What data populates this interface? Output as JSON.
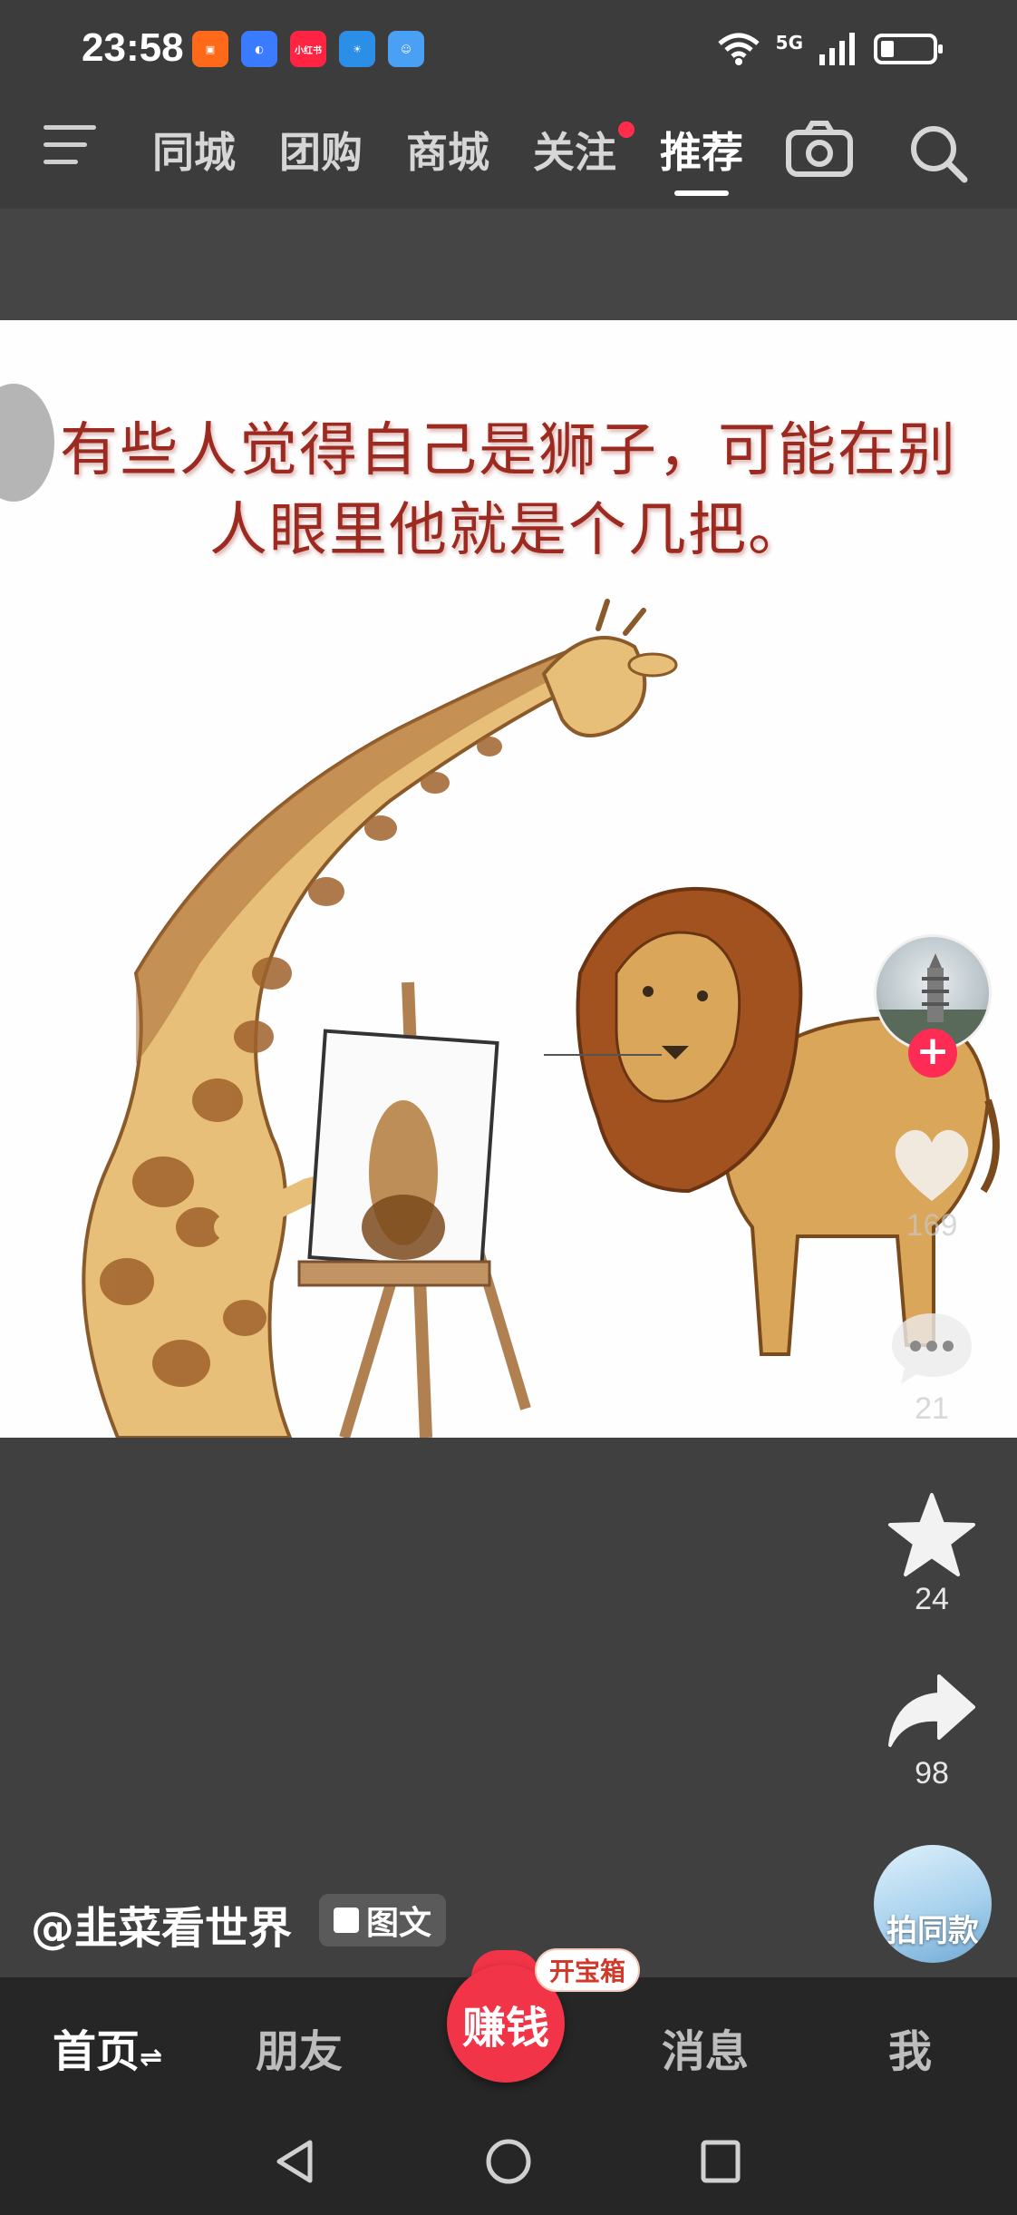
{
  "status_bar": {
    "time": "23:58",
    "network": "5G",
    "apps": [
      {
        "name": "kuaishou-app-icon",
        "color": "#ff6a1a"
      },
      {
        "name": "browser-app-icon",
        "color": "#3b7bff"
      },
      {
        "name": "xiaohongshu-app-icon",
        "color": "#ff2442",
        "label": "小红书"
      },
      {
        "name": "weather-app-icon",
        "color": "#2b8fe8"
      },
      {
        "name": "chat-app-icon",
        "color": "#4aa0f5"
      }
    ]
  },
  "top_nav": {
    "tabs": [
      {
        "label": "同城",
        "active": false
      },
      {
        "label": "团购",
        "active": false
      },
      {
        "label": "商城",
        "active": false
      },
      {
        "label": "关注",
        "active": false,
        "notification_dot": true
      },
      {
        "label": "推荐",
        "active": true
      }
    ],
    "icons": [
      "menu-icon",
      "camera-icon",
      "search-icon"
    ]
  },
  "post": {
    "caption": "有些人觉得自己是狮子，可能在别人眼里他就是个几把。",
    "caption_line1": "有些人觉得自己是狮子，可能在别",
    "caption_line2": "人眼里他就是个几把。",
    "author": "@韭菜看世界",
    "type_tag": "图文"
  },
  "actions": {
    "likes": "169",
    "comments": "21",
    "favorites": "24",
    "shares": "98",
    "same_style_label": "拍同款",
    "follow_symbol": "+"
  },
  "bottom_nav": {
    "items": [
      "首页",
      "朋友",
      "赚钱",
      "消息",
      "我"
    ],
    "home_suffix": "⇌",
    "earn_bubble": "开宝箱"
  },
  "colors": {
    "accent": "#fe2c55",
    "earn_red": "#f23448",
    "caption_red": "#9c2a20"
  }
}
